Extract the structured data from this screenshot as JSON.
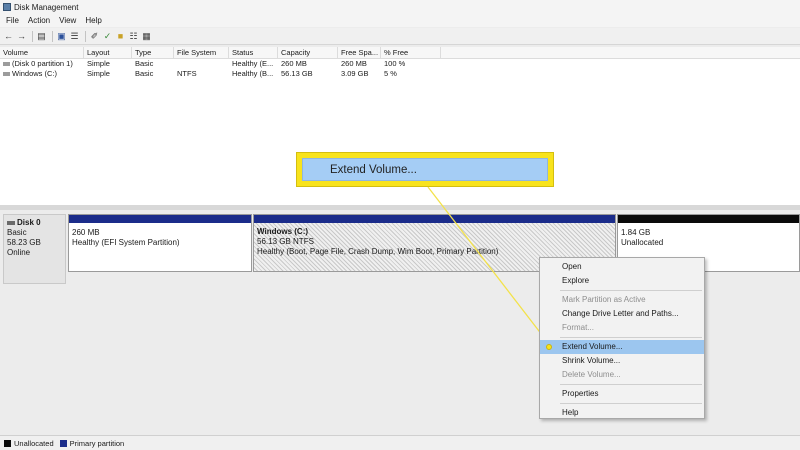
{
  "window": {
    "title": "Disk Management"
  },
  "menu": [
    "File",
    "Action",
    "View",
    "Help"
  ],
  "toolbar": {
    "icons": [
      "back-arrow-icon",
      "forward-arrow-icon",
      "console-icon",
      "help-icon",
      "list-icon",
      "properties-icon",
      "check-icon",
      "refresh-icon",
      "folder-icon",
      "grid-icon"
    ]
  },
  "volumes": {
    "columns": [
      "Volume",
      "Layout",
      "Type",
      "File System",
      "Status",
      "Capacity",
      "Free Spa...",
      "% Free"
    ],
    "rows": [
      [
        "(Disk 0 partition 1)",
        "Simple",
        "Basic",
        "",
        "Healthy (E...",
        "260 MB",
        "260 MB",
        "100 %"
      ],
      [
        "Windows (C:)",
        "Simple",
        "Basic",
        "NTFS",
        "Healthy (B...",
        "56.13 GB",
        "3.09 GB",
        "5 %"
      ]
    ]
  },
  "disk": {
    "name": "Disk 0",
    "type": "Basic",
    "size": "58.23 GB",
    "status": "Online",
    "partitions": [
      {
        "title": "",
        "size": "260 MB",
        "status": "Healthy (EFI System Partition)"
      },
      {
        "title": "Windows  (C:)",
        "size": "56.13 GB NTFS",
        "status": "Healthy (Boot, Page File, Crash Dump, Wim Boot, Primary Partition)"
      },
      {
        "title": "",
        "size": "1.84 GB",
        "status": "Unallocated"
      }
    ]
  },
  "callout": {
    "label": "Extend Volume..."
  },
  "context_menu": {
    "items": [
      {
        "label": "Open",
        "disabled": false
      },
      {
        "label": "Explore",
        "disabled": false
      },
      {
        "label": "Mark Partition as Active",
        "disabled": true
      },
      {
        "label": "Change Drive Letter and Paths...",
        "disabled": false
      },
      {
        "label": "Format...",
        "disabled": true
      },
      {
        "label": "Extend Volume...",
        "disabled": false,
        "active": true
      },
      {
        "label": "Shrink Volume...",
        "disabled": false
      },
      {
        "label": "Delete Volume...",
        "disabled": true
      },
      {
        "label": "Properties",
        "disabled": false
      },
      {
        "label": "Help",
        "disabled": false
      }
    ]
  },
  "legend": {
    "unallocated": "Unallocated",
    "primary": "Primary partition"
  },
  "colors": {
    "primary": "#1b2c8a",
    "unallocated": "#0a0a0a",
    "highlight": "#f8e31c",
    "selection": "#9cc6ef"
  }
}
